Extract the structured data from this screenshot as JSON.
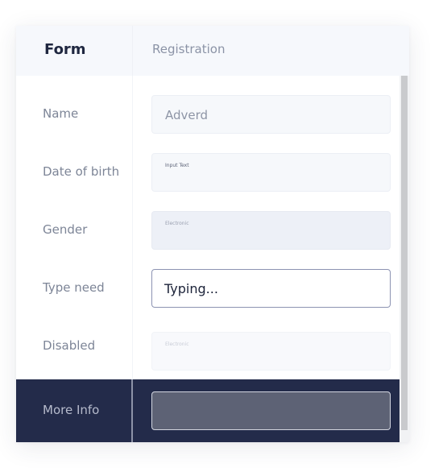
{
  "header": {
    "title": "Form",
    "subtitle": "Registration"
  },
  "rows": {
    "name": {
      "label": "Name",
      "value": "Adverd"
    },
    "dob": {
      "label": "Date of birth",
      "field_label": "Input Text"
    },
    "gender": {
      "label": "Gender",
      "field_label": "Electronic"
    },
    "type_need": {
      "label": "Type need",
      "value": "Typing..."
    },
    "disabled": {
      "label": "Disabled",
      "field_label": "Electronic"
    },
    "more_info": {
      "label": "More Info",
      "value": ""
    }
  },
  "colors": {
    "header_bg": "#f6f8fc",
    "accent_dark": "#232b4a",
    "focused_border": "#8c93b2",
    "field_bg": "#f6f8fb"
  }
}
